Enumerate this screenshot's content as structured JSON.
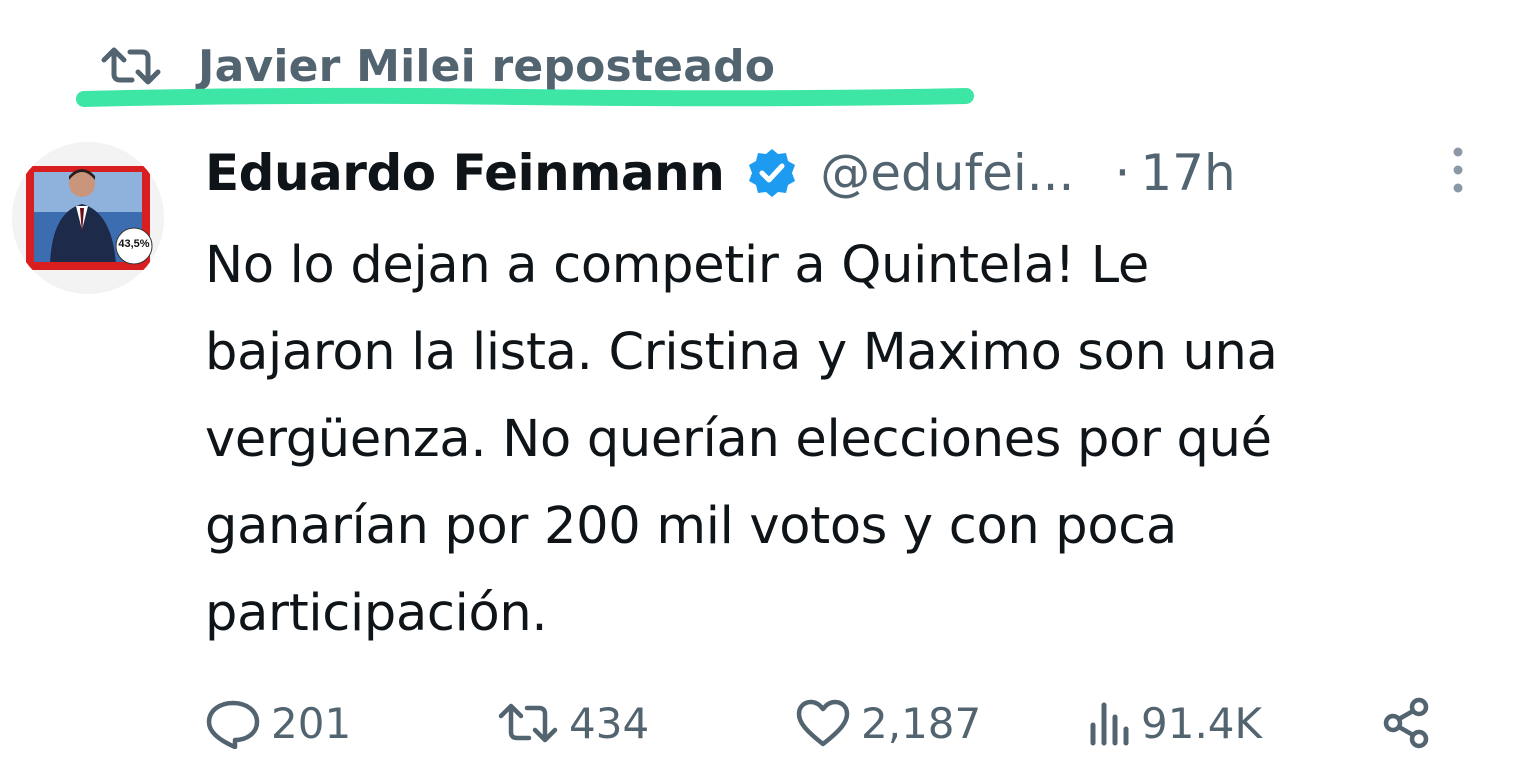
{
  "repost": {
    "label": "Javier Milei reposteado",
    "icon": "repost-icon"
  },
  "tweet": {
    "author_name": "Eduardo Feinmann",
    "handle": "@edufei...",
    "separator": "·",
    "time": "17h",
    "verified": true,
    "avatar": {
      "icon": "avatar",
      "badge_text": "43,5%"
    },
    "text": "No lo dejan a competir a Quintela!  Le\nbajaron la lista. Cristina y Maximo son una\nvergüenza. No querían elecciones por qué\nganarían por 200 mil votos y con poca\nparticipación.",
    "more_icon": "more-vertical-icon"
  },
  "actions": {
    "reply": {
      "icon": "reply-icon",
      "count": "201"
    },
    "repost": {
      "icon": "repost-icon",
      "count": "434"
    },
    "like": {
      "icon": "heart-icon",
      "count": "2,187"
    },
    "views": {
      "icon": "views-icon",
      "count": "91.4K"
    },
    "share": {
      "icon": "share-icon"
    }
  },
  "colors": {
    "text_primary": "#0f1419",
    "text_secondary": "#536471",
    "verified_blue": "#1d9bf0",
    "highlight": "#3ee6a6"
  }
}
